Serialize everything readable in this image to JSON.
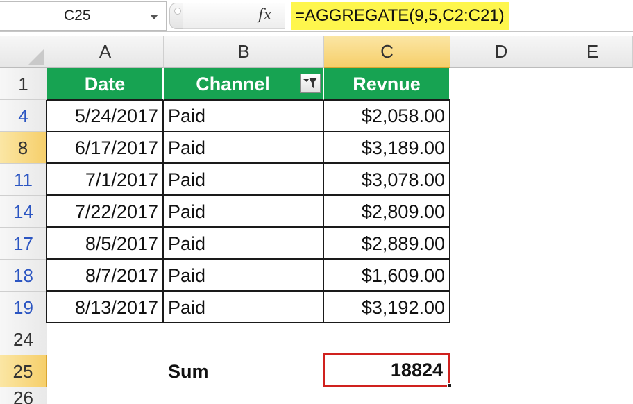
{
  "namebox": {
    "value": "C25"
  },
  "formula": {
    "text": "=AGGREGATE(9,5,C2:C21)"
  },
  "columns": [
    "A",
    "B",
    "C",
    "D",
    "E"
  ],
  "header": {
    "date": "Date",
    "channel": "Channel",
    "revenue": "Revnue"
  },
  "rows": [
    {
      "num": "4",
      "date": "5/24/2017",
      "channel": "Paid",
      "revenue": "$2,058.00"
    },
    {
      "num": "8",
      "date": "6/17/2017",
      "channel": "Paid",
      "revenue": "$3,189.00"
    },
    {
      "num": "11",
      "date": "7/1/2017",
      "channel": "Paid",
      "revenue": "$3,078.00"
    },
    {
      "num": "14",
      "date": "7/22/2017",
      "channel": "Paid",
      "revenue": "$2,809.00"
    },
    {
      "num": "17",
      "date": "8/5/2017",
      "channel": "Paid",
      "revenue": "$2,889.00"
    },
    {
      "num": "18",
      "date": "8/7/2017",
      "channel": "Paid",
      "revenue": "$1,609.00"
    },
    {
      "num": "19",
      "date": "8/13/2017",
      "channel": "Paid",
      "revenue": "$3,192.00"
    }
  ],
  "row_header_first": "1",
  "row_24": "24",
  "row_25": "25",
  "row_26": "26",
  "sum": {
    "label": "Sum",
    "value": "18824"
  },
  "colors": {
    "header_green": "#17a352",
    "formula_highlight": "#fef64d",
    "selection_red": "#d0211e"
  },
  "icons": {
    "filter": "filter-dropdown-icon",
    "fx": "function-icon"
  }
}
